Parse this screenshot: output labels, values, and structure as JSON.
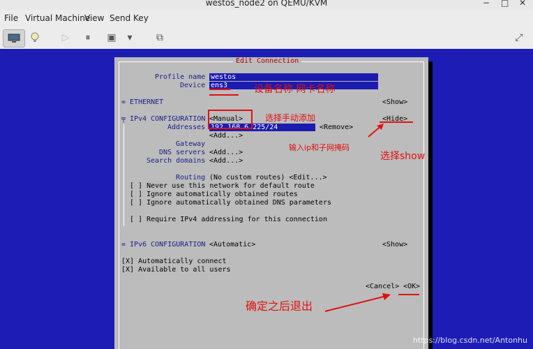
{
  "window": {
    "title": "westos_node2 on QEMU/KVM",
    "min": "−",
    "max": "□",
    "close": "✕"
  },
  "menu": [
    "File",
    "Virtual Machine",
    "View",
    "Send Key"
  ],
  "toolbar": {
    "monitor_icon": "monitor-icon",
    "bulb_icon": "lightbulb-icon",
    "play": "▷",
    "pause": "⏸",
    "power": "▣",
    "dropdown": "▾",
    "snapshots": "⧉",
    "fullscreen": "⤢"
  },
  "dialog": {
    "title": "Edit Connection",
    "profile_label": "Profile name",
    "profile_value": "westos",
    "device_label": "Device",
    "device_value": "ens3",
    "ethernet_label": "= ETHERNET",
    "ethernet_show": "<Show>",
    "ipv4_label": "╤ IPv4 CONFIGURATION",
    "ipv4_method": "<Manual>",
    "ipv4_hide": "<Hide>",
    "addresses_label": "Addresses",
    "addresses_value": "192.168.6.225/24",
    "remove": "<Remove>",
    "add": "<Add...>",
    "gateway_label": "Gateway",
    "gateway_value": "",
    "dns_label": "DNS servers",
    "dns_add": "<Add...>",
    "search_label": "Search domains",
    "search_add": "<Add...>",
    "routing_label": "Routing",
    "routing_value": "(No custom routes) <Edit...>",
    "never_default": "[ ] Never use this network for default route",
    "ignore_routes": "[ ] Ignore automatically obtained routes",
    "ignore_dns": "[ ] Ignore automatically obtained DNS parameters",
    "require_ipv4": "[ ] Require IPv4 addressing for this connection",
    "ipv6_label": "= IPv6 CONFIGURATION",
    "ipv6_method": "<Automatic>",
    "ipv6_show": "<Show>",
    "auto_connect": "[X] Automatically connect",
    "all_users": "[X] Available to all users",
    "cancel": "<Cancel>",
    "ok": "<OK>"
  },
  "annotations": {
    "names": "设备名称 网卡名称",
    "manual": "选择手动添加",
    "ip_mask": "输入ip和子网掩码",
    "show": "选择show",
    "confirm": "确定之后退出"
  },
  "watermark": "https://blog.csdn.net/Antonhu",
  "colors": {
    "accent_red": "#e01010",
    "vm_blue": "#1d1db5",
    "field_blue": "#1b1bb0",
    "dialog_gray": "#bcbcbc"
  }
}
